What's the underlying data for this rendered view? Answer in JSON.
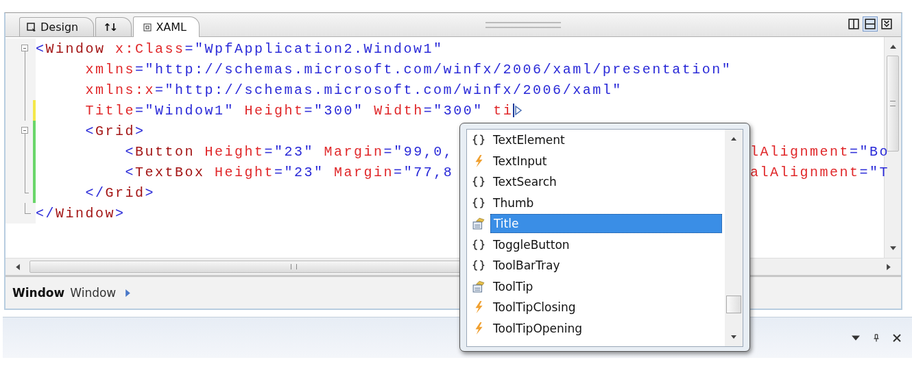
{
  "tabs": [
    {
      "label": "Design",
      "kind": "design",
      "selected": false
    },
    {
      "label": "↑↓",
      "kind": "swap",
      "selected": false
    },
    {
      "label": "XAML",
      "kind": "xaml",
      "selected": true
    }
  ],
  "view_buttons": [
    {
      "kind": "vertical",
      "selected": false
    },
    {
      "kind": "horizontal",
      "selected": true
    },
    {
      "kind": "collapse",
      "selected": false
    }
  ],
  "code_lines": [
    {
      "kind": "fold-open",
      "changed": false,
      "tokens": [
        {
          "kind": "punct",
          "t": "<"
        },
        {
          "kind": "elem",
          "t": "Window"
        },
        {
          "kind": "attr",
          "t": " x:Class"
        },
        {
          "kind": "punct",
          "t": "="
        },
        {
          "kind": "value",
          "t": "\"WpfApplication2.Window1\""
        }
      ]
    },
    {
      "kind": "fold-line",
      "changed": false,
      "tokens": [
        {
          "kind": "attr",
          "t": "     xmlns"
        },
        {
          "kind": "punct",
          "t": "="
        },
        {
          "kind": "value",
          "t": "\"http://schemas.microsoft.com/winfx/2006/xaml/presentation\""
        }
      ]
    },
    {
      "kind": "fold-line",
      "changed": false,
      "tokens": [
        {
          "kind": "attr",
          "t": "     xmlns:x"
        },
        {
          "kind": "punct",
          "t": "="
        },
        {
          "kind": "value",
          "t": "\"http://schemas.microsoft.com/winfx/2006/xaml\""
        }
      ]
    },
    {
      "kind": "fold-line",
      "changed": true,
      "color": "#f4e84a",
      "caret": true,
      "tokens": [
        {
          "kind": "attr",
          "t": "     Title"
        },
        {
          "kind": "punct",
          "t": "="
        },
        {
          "kind": "value",
          "t": "\"Window1\""
        },
        {
          "kind": "attr",
          "t": " Height"
        },
        {
          "kind": "punct",
          "t": "="
        },
        {
          "kind": "value",
          "t": "\"300\""
        },
        {
          "kind": "attr",
          "t": " Width"
        },
        {
          "kind": "punct",
          "t": "="
        },
        {
          "kind": "value",
          "t": "\"300\""
        },
        {
          "kind": "attr",
          "t": " ti"
        }
      ]
    },
    {
      "kind": "fold-open",
      "changed": true,
      "color": "#6ad66a",
      "tokens": [
        {
          "kind": "punct",
          "t": "     <"
        },
        {
          "kind": "elem",
          "t": "Grid"
        },
        {
          "kind": "punct",
          "t": ">"
        }
      ]
    },
    {
      "kind": "fold-line",
      "changed": true,
      "color": "#6ad66a",
      "tokens": [
        {
          "kind": "punct",
          "t": "         <"
        },
        {
          "kind": "elem",
          "t": "Button"
        },
        {
          "kind": "attr",
          "t": " Height"
        },
        {
          "kind": "punct",
          "t": "="
        },
        {
          "kind": "value",
          "t": "\"23\""
        },
        {
          "kind": "attr",
          "t": " Margin"
        },
        {
          "kind": "punct",
          "t": "="
        },
        {
          "kind": "value",
          "t": "\"99,0,"
        }
      ],
      "tail": [
        {
          "kind": "attr",
          "t": "lAlignment"
        },
        {
          "kind": "punct",
          "t": "="
        },
        {
          "kind": "value",
          "t": "\"Bo"
        }
      ]
    },
    {
      "kind": "fold-line",
      "changed": true,
      "color": "#6ad66a",
      "tokens": [
        {
          "kind": "punct",
          "t": "         <"
        },
        {
          "kind": "elem",
          "t": "TextBox"
        },
        {
          "kind": "attr",
          "t": " Height"
        },
        {
          "kind": "punct",
          "t": "="
        },
        {
          "kind": "value",
          "t": "\"23\""
        },
        {
          "kind": "attr",
          "t": " Margin"
        },
        {
          "kind": "punct",
          "t": "="
        },
        {
          "kind": "value",
          "t": "\"77,8"
        }
      ],
      "tail": [
        {
          "kind": "attr",
          "t": "alAlignment"
        },
        {
          "kind": "punct",
          "t": "="
        },
        {
          "kind": "value",
          "t": "\"T"
        }
      ]
    },
    {
      "kind": "fold-inner-end",
      "changed": true,
      "color": "#6ad66a",
      "tokens": [
        {
          "kind": "punct",
          "t": "     </"
        },
        {
          "kind": "elem",
          "t": "Grid"
        },
        {
          "kind": "punct",
          "t": ">"
        }
      ]
    },
    {
      "kind": "fold-end",
      "changed": false,
      "tokens": [
        {
          "kind": "punct",
          "t": "</"
        },
        {
          "kind": "elem",
          "t": "Window"
        },
        {
          "kind": "punct",
          "t": ">"
        }
      ]
    }
  ],
  "breadcrumb": {
    "element": "Window",
    "name": "Window"
  },
  "completion_list": [
    {
      "kind": "class",
      "label": "TextElement",
      "selected": false
    },
    {
      "kind": "event",
      "label": "TextInput",
      "selected": false
    },
    {
      "kind": "class",
      "label": "TextSearch",
      "selected": false
    },
    {
      "kind": "class",
      "label": "Thumb",
      "selected": false
    },
    {
      "kind": "property",
      "label": "Title",
      "selected": true
    },
    {
      "kind": "class",
      "label": "ToggleButton",
      "selected": false
    },
    {
      "kind": "class",
      "label": "ToolBarTray",
      "selected": false
    },
    {
      "kind": "property",
      "label": "ToolTip",
      "selected": false
    },
    {
      "kind": "event",
      "label": "ToolTipClosing",
      "selected": false
    },
    {
      "kind": "event",
      "label": "ToolTipOpening",
      "selected": false
    }
  ]
}
